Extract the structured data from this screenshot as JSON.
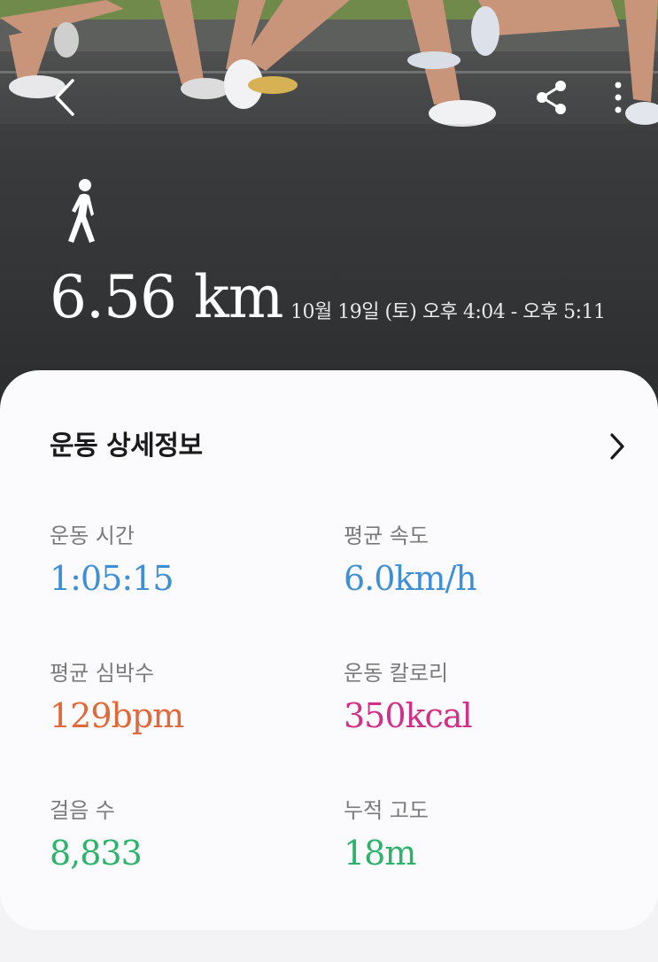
{
  "workout": {
    "distance": "6.56 km",
    "time_range": "10월 19일 (토) 오후 4:04 - 오후 5:11"
  },
  "icons": {
    "back": "back-arrow-icon",
    "share": "share-icon",
    "more": "more-vertical-icon",
    "activity": "walking-person-icon",
    "details": "chevron-right-icon"
  },
  "details": {
    "title": "운동 상세정보",
    "stats": [
      {
        "label": "운동 시간",
        "value": "1:05:15",
        "color": "#3f8fd6"
      },
      {
        "label": "평균 속도",
        "value": "6.0km/h",
        "color": "#3f8fd6"
      },
      {
        "label": "평균 심박수",
        "value": "129bpm",
        "color": "#e0683a"
      },
      {
        "label": "운동 칼로리",
        "value": "350kcal",
        "color": "#d22f86"
      },
      {
        "label": "걸음 수",
        "value": "8,833",
        "color": "#2bb36a"
      },
      {
        "label": "누적 고도",
        "value": "18m",
        "color": "#2bb36a"
      }
    ]
  }
}
